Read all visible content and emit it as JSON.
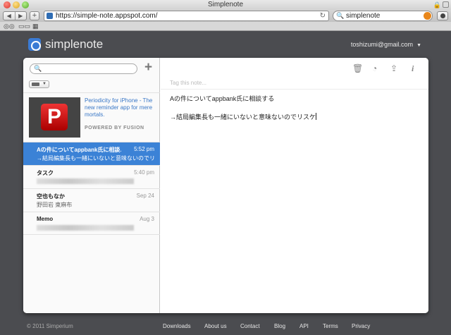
{
  "browser": {
    "window_title": "Simplenote",
    "url": "https://simple-note.appspot.com/",
    "search_query": "simplenote"
  },
  "header": {
    "logo_text": "simplenote",
    "account_email": "toshizumi@gmail.com"
  },
  "sidebar": {
    "search_placeholder": "",
    "ad": {
      "text": "Periodicity for iPhone - The new reminder app for mere mortals.",
      "powered_by": "POWERED BY FUSION",
      "logo_letter": "P"
    },
    "notes": [
      {
        "title": "Aの件についてappbank氏に相談…",
        "date": "5:52 pm",
        "preview": "→結局編集長も一緒にいないと意味ないのでリスケ",
        "selected": true
      },
      {
        "title": "タスク",
        "date": "5:40 pm",
        "preview": ""
      },
      {
        "title": "空也もなか",
        "date": "Sep 24",
        "preview": "野田岩 東麻布"
      },
      {
        "title": "Memo",
        "date": "Aug 3",
        "preview": ""
      }
    ]
  },
  "editor": {
    "tag_placeholder": "Tag this note...",
    "lines": [
      "Aの件についてappbank氏に相談する",
      "",
      "→結局編集長も一緒にいないと意味ないのでリスケ"
    ]
  },
  "footer": {
    "copyright": "© 2011 Simperium",
    "links": [
      "Downloads",
      "About us",
      "Contact",
      "Blog",
      "API",
      "Terms",
      "Privacy"
    ]
  },
  "colors": {
    "accent": "#3b82d6",
    "background": "#4b4c50"
  }
}
